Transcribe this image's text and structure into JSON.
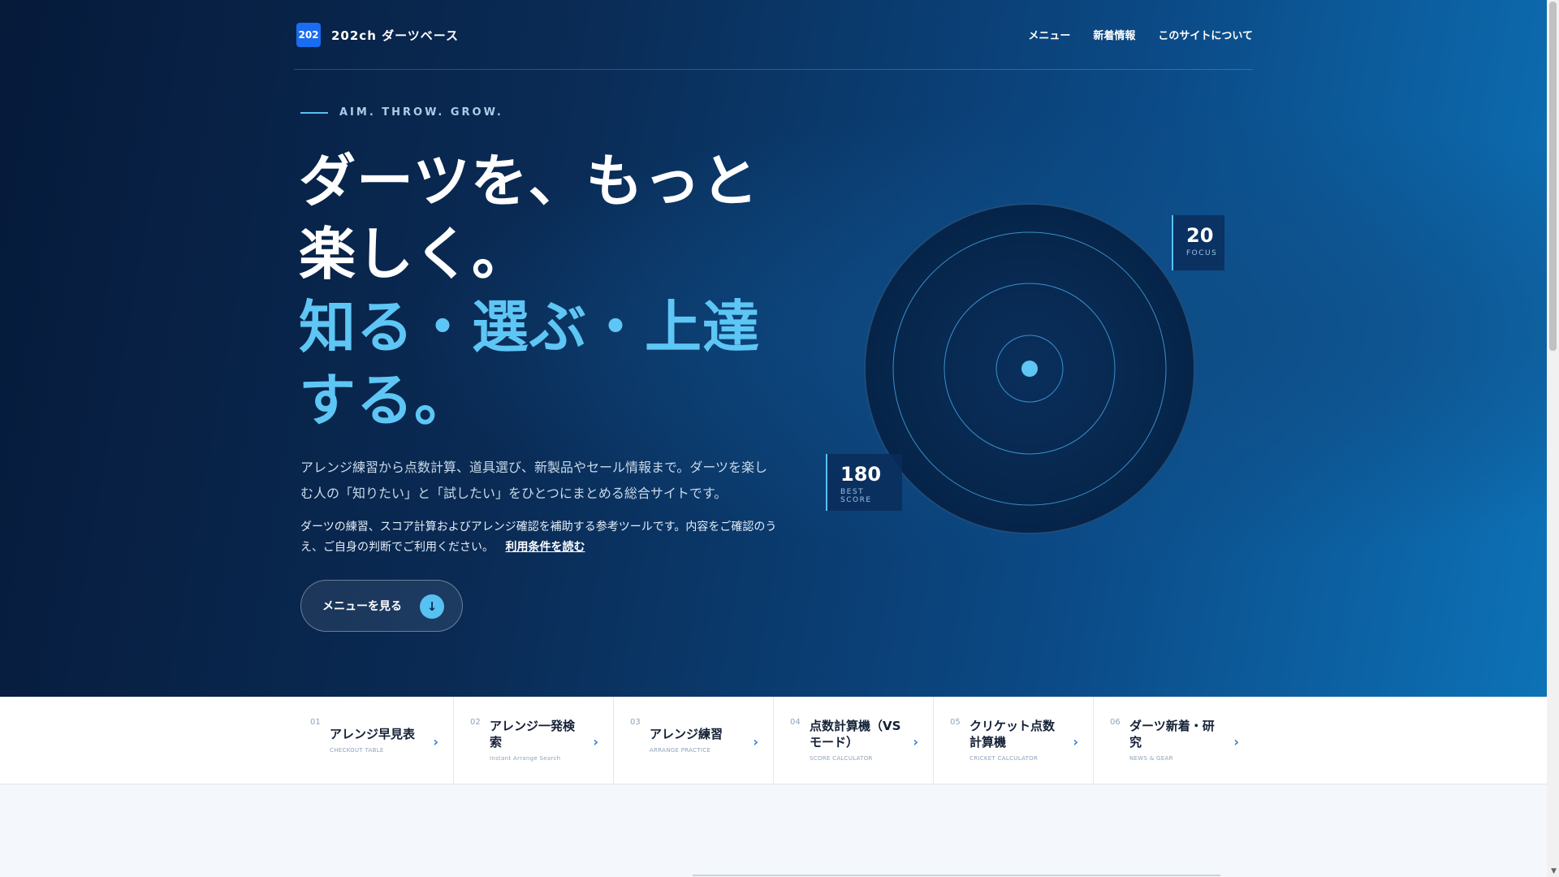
{
  "header": {
    "logo_badge": "202",
    "site_name": "202ch ダーツベース",
    "nav": [
      "メニュー",
      "新着情報",
      "このサイトについて"
    ]
  },
  "hero": {
    "tagline": "AIM. THROW. GROW.",
    "headline_white": [
      "ダーツを、もっと",
      "楽しく。"
    ],
    "headline_cyan": [
      "知る・選ぶ・上達",
      "する。"
    ],
    "lead": "アレンジ練習から点数計算、道具選び、新製品やセール情報まで。ダーツを楽しむ人の「知りたい」と「試したい」をひとつにまとめる総合サイトです。",
    "note": "ダーツの練習、スコア計算およびアレンジ確認を補助する参考ツールです。内容をご確認のうえ、ご自身の判断でご利用ください。",
    "terms_link": "利用条件を読む",
    "cta_label": "メニューを見る",
    "cta_icon": "↓"
  },
  "stats": {
    "focus": {
      "value": "20",
      "label": "FOCUS"
    },
    "best": {
      "value": "180",
      "label": "BEST SCORE"
    }
  },
  "features": [
    {
      "index": "01",
      "title": "アレンジ早見表",
      "sub": "CHECKOUT TABLE"
    },
    {
      "index": "02",
      "title": "アレンジ一発検索",
      "sub": "Instant Arrange Search"
    },
    {
      "index": "03",
      "title": "アレンジ練習",
      "sub": "ARRANGE PRACTICE"
    },
    {
      "index": "04",
      "title": "点数計算機（VSモード）",
      "sub": "SCORE CALCULATOR"
    },
    {
      "index": "05",
      "title": "クリケット点数計算機",
      "sub": "CRICKET CALCULATOR"
    },
    {
      "index": "06",
      "title": "ダーツ新着・研究",
      "sub": "NEWS & GEAR"
    }
  ],
  "colors": {
    "accent": "#57c1f1",
    "brand": "#1a6cf0",
    "hero_dark": "#061a3a",
    "hero_light": "#0d72b7"
  }
}
